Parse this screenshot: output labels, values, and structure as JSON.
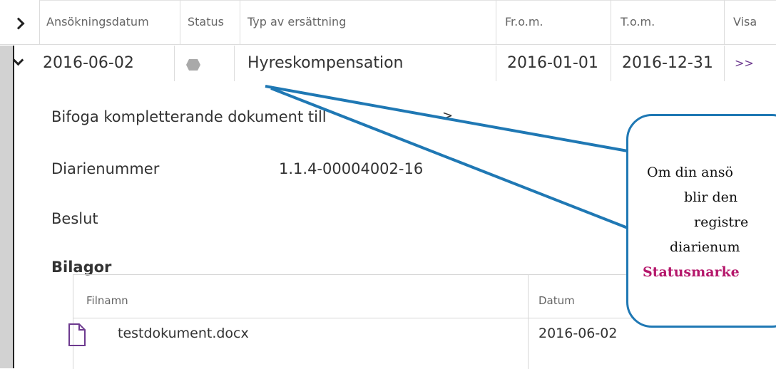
{
  "table": {
    "columns": [
      "Ansökningsdatum",
      "Status",
      "Typ av ersättning",
      "Fr.o.m.",
      "T.o.m.",
      "Visa"
    ],
    "row": {
      "ansokningsdatum": "2016-06-02",
      "typ": "Hyreskompensation",
      "from": "2016-01-01",
      "tom": "2016-12-31",
      "visa": ">>"
    }
  },
  "details": {
    "link_text": "Bifoga kompletterande dokument till",
    "link_tail": ">",
    "diarienummer_label": "Diarienummer",
    "diarienummer_value": "1.1.4-00004002-16",
    "beslut_label": "Beslut",
    "bilagor_label": "Bilagor",
    "attachments": {
      "headers": {
        "filnamn": "Filnamn",
        "datum": "Datum"
      },
      "rows": [
        {
          "filnamn": "testdokument.docx",
          "datum": "2016-06-02"
        }
      ]
    }
  },
  "callout": {
    "lines": [
      "Om din ansö",
      "blir den",
      "registre",
      "diarienum",
      "Statusmarke"
    ]
  },
  "colors": {
    "callout_border": "#1f78b4",
    "link_purple": "#6d3a8f",
    "callout_emphasis": "#b5176b"
  }
}
